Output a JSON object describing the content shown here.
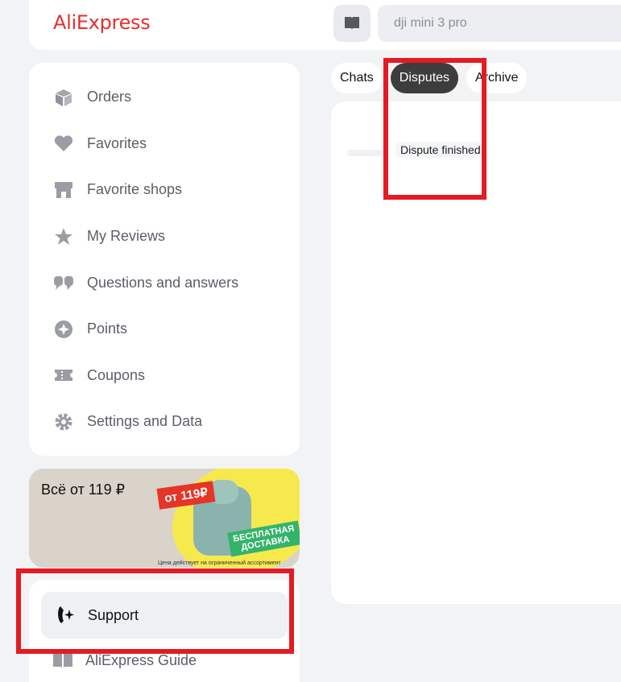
{
  "header": {
    "logo": "AliExpress",
    "search_placeholder": "dji mini 3 pro"
  },
  "sidebar": {
    "items": [
      {
        "label": "Orders",
        "icon": "box-icon"
      },
      {
        "label": "Favorites",
        "icon": "heart-icon"
      },
      {
        "label": "Favorite shops",
        "icon": "shop-icon"
      },
      {
        "label": "My Reviews",
        "icon": "star-icon"
      },
      {
        "label": "Questions and answers",
        "icon": "qa-icon"
      },
      {
        "label": "Points",
        "icon": "points-icon"
      },
      {
        "label": "Coupons",
        "icon": "coupon-icon"
      },
      {
        "label": "Settings and Data",
        "icon": "gear-icon"
      }
    ]
  },
  "promo": {
    "text": "Всё от 119 ₽",
    "price_tag": "от 119₽",
    "free_delivery": "БЕСПЛАТНАЯ ДОСТАВКА",
    "note": "Цена действует на ограниченный ассортимент"
  },
  "support": {
    "label": "Support",
    "guide_label": "AliExpress Guide"
  },
  "tabs": [
    {
      "label": "Chats",
      "active": false
    },
    {
      "label": "Disputes",
      "active": true
    },
    {
      "label": "Archive",
      "active": false
    }
  ],
  "content": {
    "dispute_status": "Dispute finished"
  },
  "colors": {
    "brand": "#e62e2e",
    "highlight": "#e41b23"
  }
}
